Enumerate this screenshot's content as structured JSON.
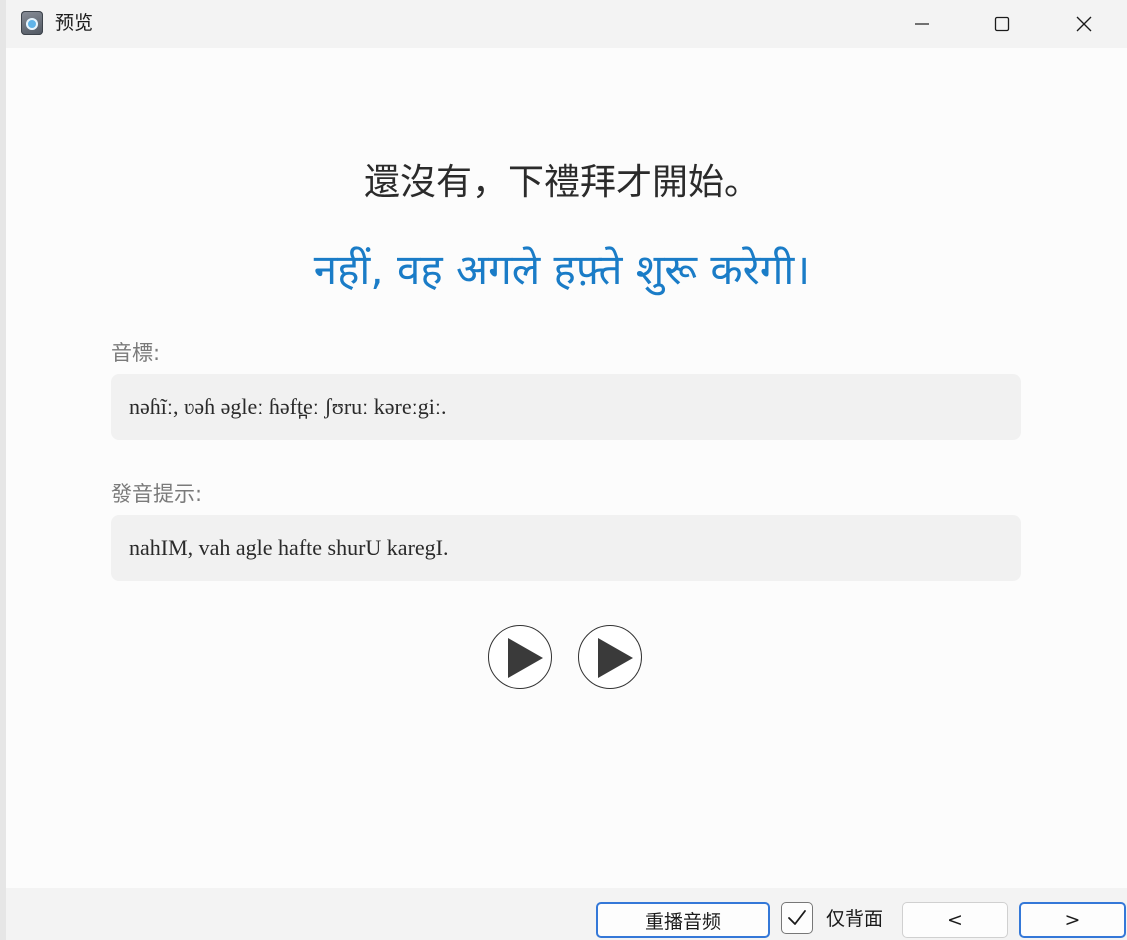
{
  "window": {
    "title": "预览"
  },
  "content": {
    "source_text": "還沒有，下禮拜才開始。",
    "target_text": "नहीं, वह अगले हफ़्ते शुरू करेगी।",
    "ipa_label": "音標:",
    "ipa_value": "nəɦĩː, ʋəɦ əgleː ɦəft̪eː ʃʊruː kəreːgiː.",
    "hint_label": "發音提示:",
    "hint_value": "nahIM, vah agle hafte shurU karegI."
  },
  "toolbar": {
    "replay_label": "重播音频",
    "back_only_checked": true,
    "back_only_label": "仅背面",
    "prev_label": "<",
    "next_label": ">"
  },
  "colors": {
    "accent": "#1a7cc7",
    "focus_border": "#3478d8"
  },
  "icons": {
    "app": "app-icon",
    "minimize": "minimize-icon",
    "maximize": "maximize-icon",
    "close": "close-icon",
    "play": "play-icon",
    "check": "checkmark-icon"
  }
}
